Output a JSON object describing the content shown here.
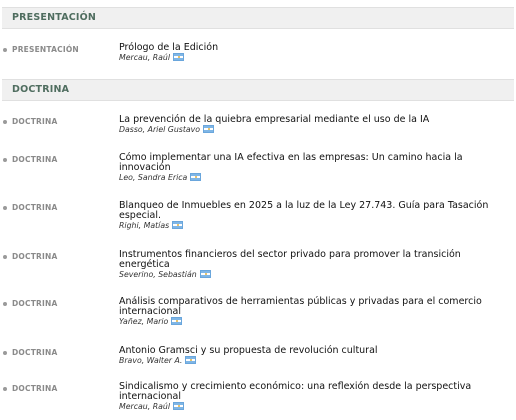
{
  "sections": {
    "presentacion": {
      "label": "PRESENTACIÓN"
    },
    "doctrina": {
      "label": "DOCTRINA"
    }
  },
  "articles": [
    {
      "category": "PRESENTACIÓN",
      "title": "Prólogo de la Edición",
      "author": "Mercau, Raúl"
    },
    {
      "category": "DOCTRINA",
      "title": "La prevención de la quiebra empresarial mediante el uso de la IA",
      "author": "Dasso, Ariel Gustavo"
    },
    {
      "category": "DOCTRINA",
      "title": "Cómo implementar una IA efectiva en las empresas: Un camino hacia la innovación",
      "author": "Leo, Sandra Erica"
    },
    {
      "category": "DOCTRINA",
      "title": "Blanqueo de Inmuebles en 2025 a la luz de la Ley 27.743. Guía para Tasación especial.",
      "author": "Righi, Matías"
    },
    {
      "category": "DOCTRINA",
      "title": "Instrumentos financieros del sector privado para promover la transición energética",
      "author": "Severino, Sebastián"
    },
    {
      "category": "DOCTRINA",
      "title": "Análisis comparativos de herramientas públicas y privadas para el comercio internacional",
      "author": "Yañez, Mario"
    },
    {
      "category": "DOCTRINA",
      "title": "Antonio Gramsci y su propuesta de revolución cultural",
      "author": "Bravo, Walter A."
    },
    {
      "category": "DOCTRINA",
      "title": "Sindicalismo y crecimiento económico: una reflexión desde la perspectiva internacional",
      "author": "Mercau, Raúl"
    }
  ],
  "icons": {
    "author_flag": "argentina-flag-icon"
  }
}
